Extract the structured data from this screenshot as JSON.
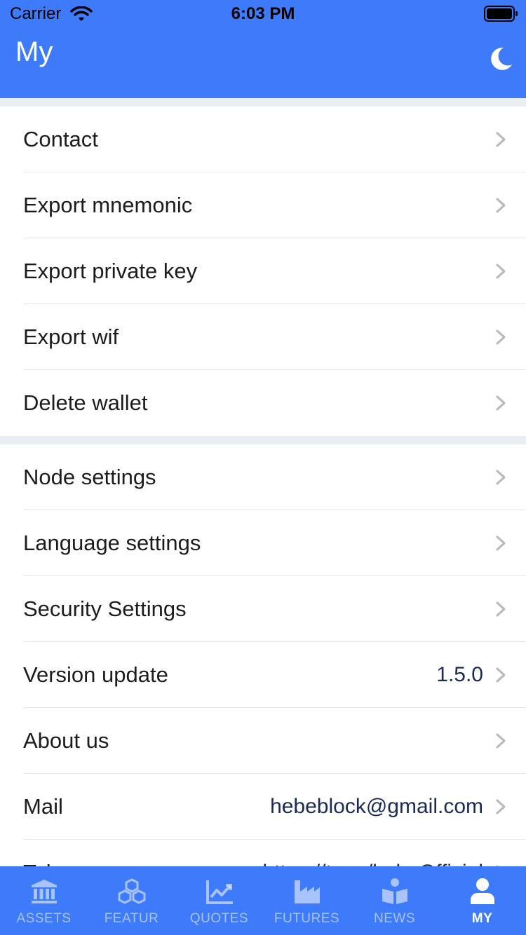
{
  "status_bar": {
    "carrier": "Carrier",
    "time": "6:03 PM"
  },
  "header": {
    "title": "My",
    "theme_icon": "moon-icon"
  },
  "groups": [
    {
      "items": [
        {
          "label": "Contact",
          "value": ""
        },
        {
          "label": "Export mnemonic",
          "value": ""
        },
        {
          "label": "Export private key",
          "value": ""
        },
        {
          "label": "Export wif",
          "value": ""
        },
        {
          "label": "Delete wallet",
          "value": ""
        }
      ]
    },
    {
      "items": [
        {
          "label": "Node settings",
          "value": ""
        },
        {
          "label": "Language settings",
          "value": ""
        },
        {
          "label": "Security Settings",
          "value": ""
        },
        {
          "label": "Version update",
          "value": "1.5.0"
        },
        {
          "label": "About us",
          "value": ""
        },
        {
          "label": "Mail",
          "value": "hebeblock@gmail.com"
        },
        {
          "label": "Telegram",
          "value": "https://t.me/hebeOfficial"
        }
      ]
    }
  ],
  "tabbar": {
    "tabs": [
      {
        "label": "ASSETS",
        "icon": "bank-icon",
        "active": false
      },
      {
        "label": "FEATUR",
        "icon": "cubes-icon",
        "active": false
      },
      {
        "label": "QUOTES",
        "icon": "chart-icon",
        "active": false
      },
      {
        "label": "FUTURES",
        "icon": "factory-icon",
        "active": false
      },
      {
        "label": "NEWS",
        "icon": "book-reader-icon",
        "active": false
      },
      {
        "label": "MY",
        "icon": "user-icon",
        "active": true
      }
    ]
  },
  "colors": {
    "primary": "#3e7bfa",
    "background": "#e9eef3",
    "text": "#1c1c1e",
    "value_text": "#1a2b5a"
  }
}
